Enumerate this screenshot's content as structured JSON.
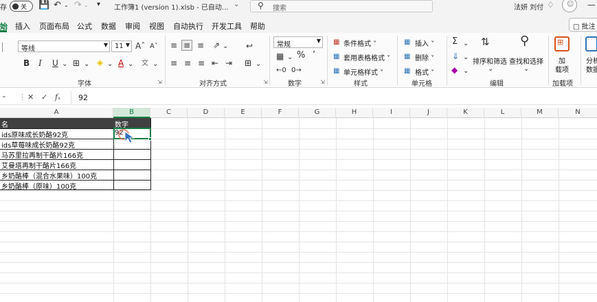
{
  "titlebar": {
    "autosave_label": "存",
    "toggle_label": "关",
    "filename": "工作簿1 (version 1).xlsb  -  已自动...",
    "search_placeholder": "搜索",
    "user_name": "法妍 刘付"
  },
  "tabs": [
    "开始",
    "插入",
    "页面布局",
    "公式",
    "数据",
    "审阅",
    "视图",
    "自动执行",
    "开发工具",
    "帮助"
  ],
  "active_tab_label": "始",
  "comment_button": "批注",
  "ribbon": {
    "font_name": "等线",
    "font_size": "11",
    "number_format": "常规",
    "groups": {
      "font": "字体",
      "alignment": "对齐方式",
      "number": "数字",
      "styles": "样式",
      "cells": "单元格",
      "editing": "编辑",
      "addins": "加载项"
    },
    "styles_buttons": [
      "条件格式 ˅",
      "套用表格格式 ˅",
      "单元格样式 ˅"
    ],
    "cells_buttons": [
      "插入 ˅",
      "删除 ˅",
      "格式 ˅"
    ],
    "sort_filter": "排序和筛选",
    "find_select": "查找和选择",
    "addins_button_line1": "加",
    "addins_button_line2": "载项",
    "analyze_line1": "分析",
    "analyze_line2": "数据"
  },
  "formula_bar": {
    "name_box": "",
    "content": "92"
  },
  "columns": [
    "A",
    "B",
    "C",
    "D",
    "E",
    "F",
    "G",
    "H",
    "I",
    "J",
    "K",
    "L",
    "M",
    "N"
  ],
  "table": {
    "header": {
      "a": "名",
      "b": "数字"
    },
    "rows": [
      {
        "a": "ids原味成长奶酪92克",
        "b": "92"
      },
      {
        "a": "ids草莓味成长奶酪92克",
        "b": ""
      },
      {
        "a": "马苏里拉再制干酪片166克",
        "b": ""
      },
      {
        "a": "艾曼塔再制干酪片166克",
        "b": ""
      },
      {
        "a": "乡奶酪棒（混合水果味）100克",
        "b": ""
      },
      {
        "a": "乡奶酪棒（原味）100克",
        "b": ""
      }
    ]
  },
  "colors": {
    "accent": "#107c41",
    "header_fill": "#404040"
  }
}
